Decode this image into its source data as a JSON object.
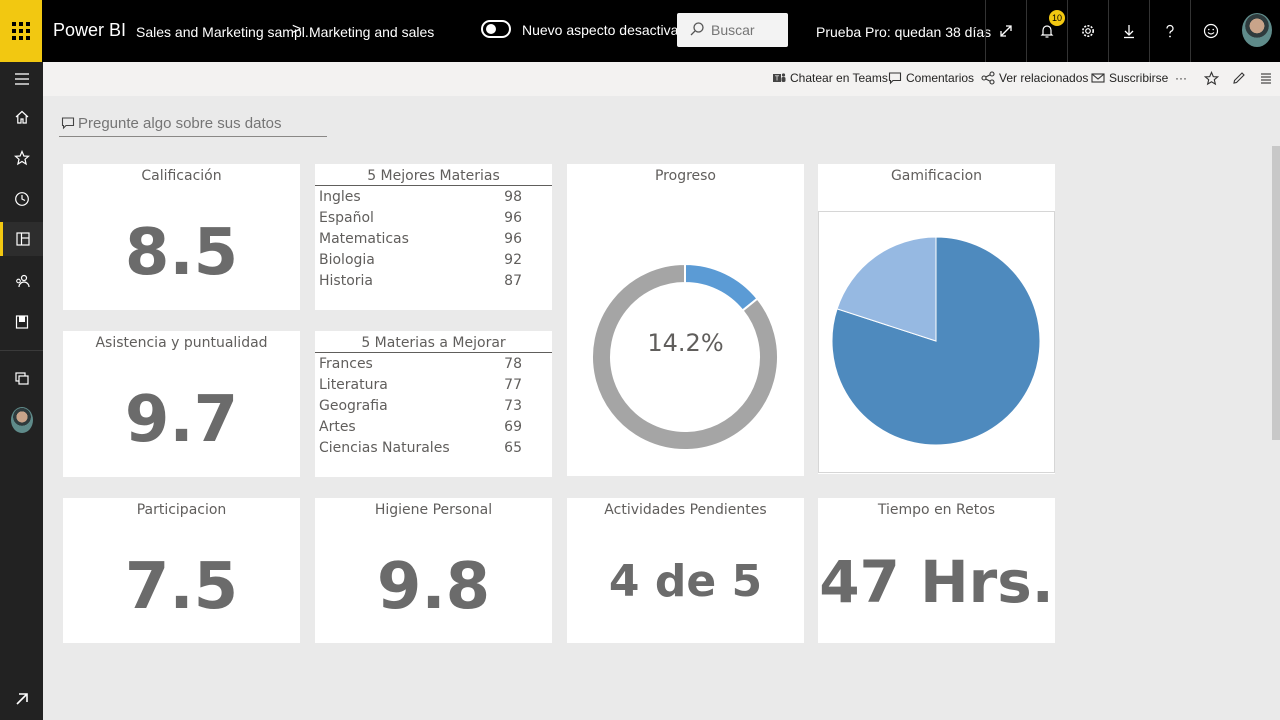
{
  "app": {
    "brand": "Power BI",
    "breadcrumb": [
      "Sales and Marketing sampl...",
      "Marketing and sales"
    ],
    "breadcrumb_separator": ">",
    "new_look_toggle_label": "Nuevo aspecto desactivado",
    "new_look_enabled": false,
    "search_placeholder": "Buscar",
    "trial_text": "Prueba Pro: quedan 38 días",
    "notification_count": "10",
    "accent_color": "#f2c811"
  },
  "toolbar_icons": [
    "expand-icon",
    "bell-icon",
    "gear-icon",
    "download-icon",
    "help-icon",
    "smiley-icon"
  ],
  "left_nav": [
    "hamburger-icon",
    "home-icon",
    "star-icon",
    "clock-icon",
    "workspace-icon",
    "people-icon",
    "book-icon",
    "apps-icon"
  ],
  "actions": {
    "teams": "Chatear en Teams",
    "comments": "Comentarios",
    "related": "Ver relacionados",
    "subscribe": "Suscribirse",
    "more": "···"
  },
  "qna": {
    "placeholder": "Pregunte algo sobre sus datos"
  },
  "tiles": {
    "calificacion": {
      "title": "Calificación",
      "value": "8.5"
    },
    "asistencia": {
      "title": "Asistencia y puntualidad",
      "value": "9.7"
    },
    "participacion": {
      "title": "Participacion",
      "value": "7.5"
    },
    "higiene": {
      "title": "Higiene Personal",
      "value": "9.8"
    },
    "pendientes": {
      "title": "Actividades Pendientes",
      "value": "4 de 5"
    },
    "retos": {
      "title": "Tiempo en Retos",
      "value": "47 Hrs."
    },
    "progreso": {
      "title": "Progreso",
      "label": "14.2%"
    },
    "gamificacion": {
      "title": "Gamificacion"
    },
    "mejores": {
      "title": "5 Mejores Materias",
      "rows": [
        {
          "name": "Ingles",
          "value": "98"
        },
        {
          "name": "Español",
          "value": "96"
        },
        {
          "name": "Matematicas",
          "value": "96"
        },
        {
          "name": "Biologia",
          "value": "92"
        },
        {
          "name": "Historia",
          "value": "87"
        }
      ]
    },
    "mejorar": {
      "title": "5 Materias a Mejorar",
      "rows": [
        {
          "name": "Frances",
          "value": "78"
        },
        {
          "name": "Literatura",
          "value": "77"
        },
        {
          "name": "Geografia",
          "value": "73"
        },
        {
          "name": "Artes",
          "value": "69"
        },
        {
          "name": "Ciencias Naturales",
          "value": "65"
        }
      ]
    }
  },
  "chart_data": [
    {
      "type": "pie",
      "variant": "donut",
      "title": "Progreso",
      "values": [
        14.2,
        85.8
      ],
      "colors": [
        "#5b9bd5",
        "#a5a5a5"
      ],
      "center_label": "14.2%"
    },
    {
      "type": "pie",
      "title": "Gamificacion",
      "values": [
        80,
        20
      ],
      "colors": [
        "#4e8abe",
        "#96b9e2"
      ]
    }
  ]
}
